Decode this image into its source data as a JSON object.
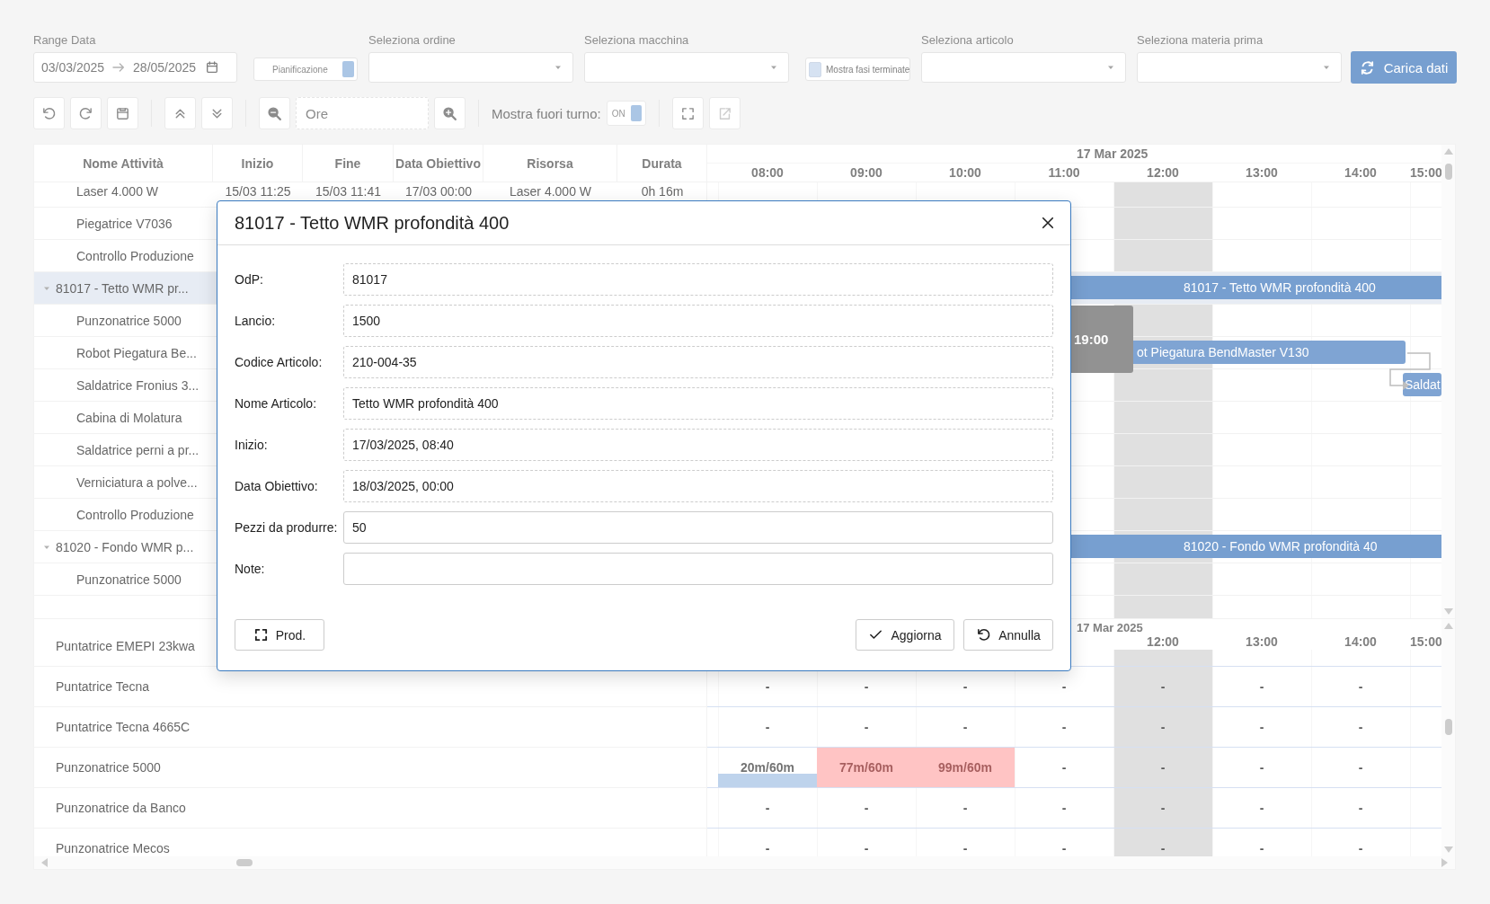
{
  "filters": [
    {
      "kind": "date_range",
      "label": "Range Data",
      "from": "03/03/2025",
      "to": "28/05/2025"
    },
    {
      "kind": "toggle",
      "label": "Pianificazione",
      "on": true
    },
    {
      "kind": "select",
      "label": "Seleziona ordine"
    },
    {
      "kind": "select",
      "label": "Seleziona macchina"
    },
    {
      "kind": "checkbox",
      "label": "Mostra fasi terminate",
      "checked": false
    },
    {
      "kind": "select",
      "label": "Seleziona articolo"
    },
    {
      "kind": "select",
      "label": "Seleziona materia prima"
    },
    {
      "kind": "button",
      "label": "Carica dati"
    }
  ],
  "toolbar": [
    [
      {
        "kind": "undo",
        "disabled": false
      },
      {
        "kind": "redo",
        "disabled": false
      },
      {
        "kind": "save",
        "disabled": false
      }
    ],
    [
      {
        "kind": "collapse_all",
        "disabled": false
      },
      {
        "kind": "expand_all",
        "disabled": false
      }
    ],
    [
      {
        "kind": "zoom_out",
        "disabled": false
      },
      {
        "kind": "field",
        "placeholder": "Ore"
      },
      {
        "kind": "zoom_in",
        "disabled": false
      }
    ],
    [
      {
        "kind": "switch",
        "label": "Mostra fuori turno:",
        "value": "ON",
        "on": true
      }
    ],
    [
      {
        "kind": "fullscreen",
        "disabled": false
      },
      {
        "kind": "export",
        "disabled": true
      }
    ]
  ],
  "gantt": {
    "columns": [
      "Nome Attività",
      "Inizio",
      "Fine",
      "Data Obiettivo",
      "Risorsa",
      "Durata"
    ],
    "date": "17 Mar 2025",
    "hours": [
      {
        "label": "08:00",
        "off": false
      },
      {
        "label": "09:00",
        "off": false
      },
      {
        "label": "10:00",
        "off": false
      },
      {
        "label": "11:00",
        "off": false
      },
      {
        "label": "12:00",
        "off": true
      },
      {
        "label": "13:00",
        "off": false
      },
      {
        "label": "14:00",
        "off": false
      },
      {
        "label": "15:00",
        "off": false
      }
    ],
    "rows": [
      {
        "kind": "task",
        "selected": false,
        "name": "Laser 4.000 W",
        "start": "15/03 11:25",
        "end": "15/03 11:41",
        "target": "17/03 00:00",
        "resource": "Laser 4.000 W",
        "duration": "0h 16m"
      },
      {
        "kind": "task",
        "selected": false,
        "name": "Piegatrice V7036"
      },
      {
        "kind": "task",
        "selected": false,
        "name": "Controllo Produzione"
      },
      {
        "kind": "order",
        "selected": true,
        "expanded": true,
        "name": "81017 - Tetto WMR pr...",
        "bar": {
          "kind": "summary",
          "label": "81017 - Tetto WMR profondità 400"
        }
      },
      {
        "kind": "task",
        "selected": false,
        "name": "Punzonatrice 5000"
      },
      {
        "kind": "task",
        "selected": false,
        "name": "Robot Piegatura Be...",
        "bar": {
          "kind": "task",
          "label": "ot Piegatura BendMaster V130",
          "link": true
        }
      },
      {
        "kind": "task",
        "selected": false,
        "name": "Saldatrice Fronius 3...",
        "bar": {
          "kind": "tail",
          "label": "Saldat"
        }
      },
      {
        "kind": "task",
        "selected": false,
        "name": "Cabina di Molatura"
      },
      {
        "kind": "task",
        "selected": false,
        "name": "Saldatrice perni a pr..."
      },
      {
        "kind": "task",
        "selected": false,
        "name": "Verniciatura a polve..."
      },
      {
        "kind": "task",
        "selected": false,
        "name": "Controllo Produzione"
      },
      {
        "kind": "order",
        "selected": false,
        "expanded": true,
        "name": "81020 - Fondo WMR p...",
        "bar": {
          "kind": "summary",
          "label": "81020 - Fondo WMR profondità 40"
        }
      },
      {
        "kind": "task",
        "selected": false,
        "name": "Punzonatrice 5000"
      }
    ],
    "tooltip": "19:00"
  },
  "load": {
    "date": "17 Mar 2025",
    "hours": [
      "12:00",
      "13:00",
      "14:00",
      "15:00"
    ],
    "rows": [
      {
        "name": "Puntatrice EMEPI 23kwa",
        "cells": []
      },
      {
        "name": "Puntatrice Tecna",
        "cells": [
          {
            "text": "-"
          },
          {
            "text": "-"
          },
          {
            "text": "-"
          },
          {
            "text": "-"
          },
          {
            "text": "-"
          },
          {
            "text": "-"
          },
          {
            "text": "-"
          }
        ]
      },
      {
        "name": "Puntatrice Tecna 4665C",
        "cells": [
          {
            "text": "-"
          },
          {
            "text": "-"
          },
          {
            "text": "-"
          },
          {
            "text": "-"
          },
          {
            "text": "-"
          },
          {
            "text": "-"
          },
          {
            "text": "-"
          }
        ]
      },
      {
        "name": "Punzonatrice 5000",
        "cells": [
          {
            "text": "20m/60m",
            "kind": "load"
          },
          {
            "text": "77m/60m",
            "kind": "over"
          },
          {
            "text": "99m/60m",
            "kind": "over"
          },
          {
            "text": "-"
          },
          {
            "text": "-"
          },
          {
            "text": "-"
          },
          {
            "text": "-"
          }
        ]
      },
      {
        "name": "Punzonatrice da Banco",
        "cells": [
          {
            "text": "-"
          },
          {
            "text": "-"
          },
          {
            "text": "-"
          },
          {
            "text": "-"
          },
          {
            "text": "-"
          },
          {
            "text": "-"
          },
          {
            "text": "-"
          }
        ]
      },
      {
        "name": "Punzonatrice Mecos",
        "cells": [
          {
            "text": "-"
          },
          {
            "text": "-"
          },
          {
            "text": "-"
          },
          {
            "text": "-"
          },
          {
            "text": "-"
          },
          {
            "text": "-"
          },
          {
            "text": "-"
          }
        ]
      }
    ]
  },
  "dialog": {
    "title": "81017 - Tetto WMR profondità 400",
    "fields": [
      {
        "label": "OdP:",
        "value": "81017",
        "readonly": true
      },
      {
        "label": "Lancio:",
        "value": "1500",
        "readonly": true
      },
      {
        "label": "Codice Articolo:",
        "value": "210-004-35",
        "readonly": true
      },
      {
        "label": "Nome Articolo:",
        "value": "Tetto WMR profondità 400",
        "readonly": true
      },
      {
        "label": "Inizio:",
        "value": "17/03/2025, 08:40",
        "readonly": true
      },
      {
        "label": "Data Obiettivo:",
        "value": "18/03/2025, 00:00",
        "readonly": true
      },
      {
        "label": "Pezzi da produrre:",
        "value": "50",
        "readonly": false
      },
      {
        "label": "Note:",
        "readonly": false
      }
    ],
    "buttons": [
      {
        "kind": "expand",
        "label": "Prod."
      },
      {
        "kind": "confirm",
        "label": "Aggiorna"
      },
      {
        "kind": "cancel",
        "label": "Annulla"
      }
    ]
  }
}
